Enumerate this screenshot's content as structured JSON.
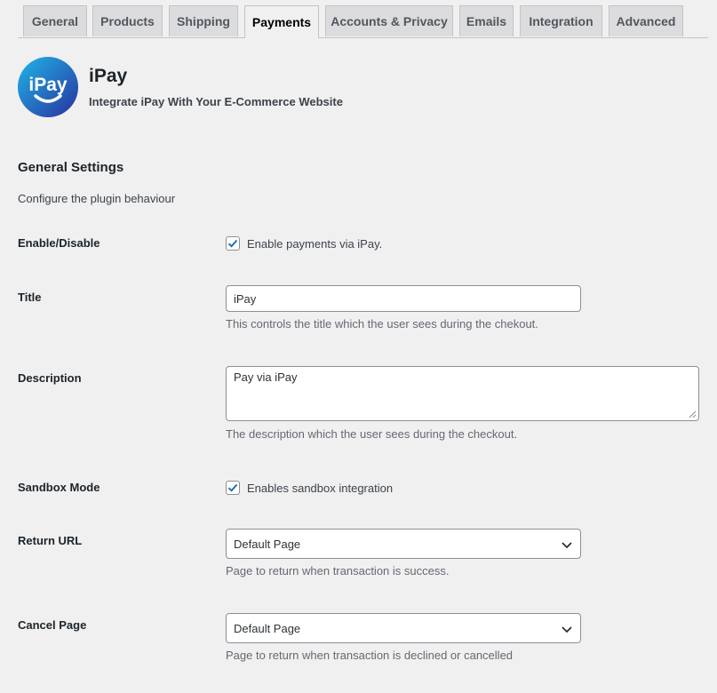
{
  "tabs": [
    {
      "label": "General"
    },
    {
      "label": "Products"
    },
    {
      "label": "Shipping"
    },
    {
      "label": "Payments",
      "active": true
    },
    {
      "label": "Accounts & Privacy"
    },
    {
      "label": "Emails"
    },
    {
      "label": "Integration"
    },
    {
      "label": "Advanced"
    }
  ],
  "plugin": {
    "logo_text": "iPay",
    "name": "iPay",
    "tagline": "Integrate iPay With Your E-Commerce Website"
  },
  "section": {
    "title": "General Settings",
    "description": "Configure the plugin behaviour"
  },
  "fields": {
    "enable": {
      "label": "Enable/Disable",
      "checked": true,
      "checkbox_label": "Enable payments via iPay."
    },
    "title": {
      "label": "Title",
      "value": "iPay",
      "description": "This controls the title which the user sees during the chekout."
    },
    "description": {
      "label": "Description",
      "value": "Pay via iPay",
      "description": "The description which the user sees during the checkout."
    },
    "sandbox": {
      "label": "Sandbox Mode",
      "checked": true,
      "checkbox_label": "Enables sandbox integration"
    },
    "return_url": {
      "label": "Return URL",
      "selected": "Default Page",
      "description": "Page to return when transaction is success."
    },
    "cancel_page": {
      "label": "Cancel Page",
      "selected": "Default Page",
      "description": "Page to return when transaction is declined or cancelled"
    }
  },
  "colors": {
    "accent": "#2271b1",
    "logo_gradient_start": "#1fb6e8",
    "logo_gradient_end": "#2a2f9e"
  }
}
